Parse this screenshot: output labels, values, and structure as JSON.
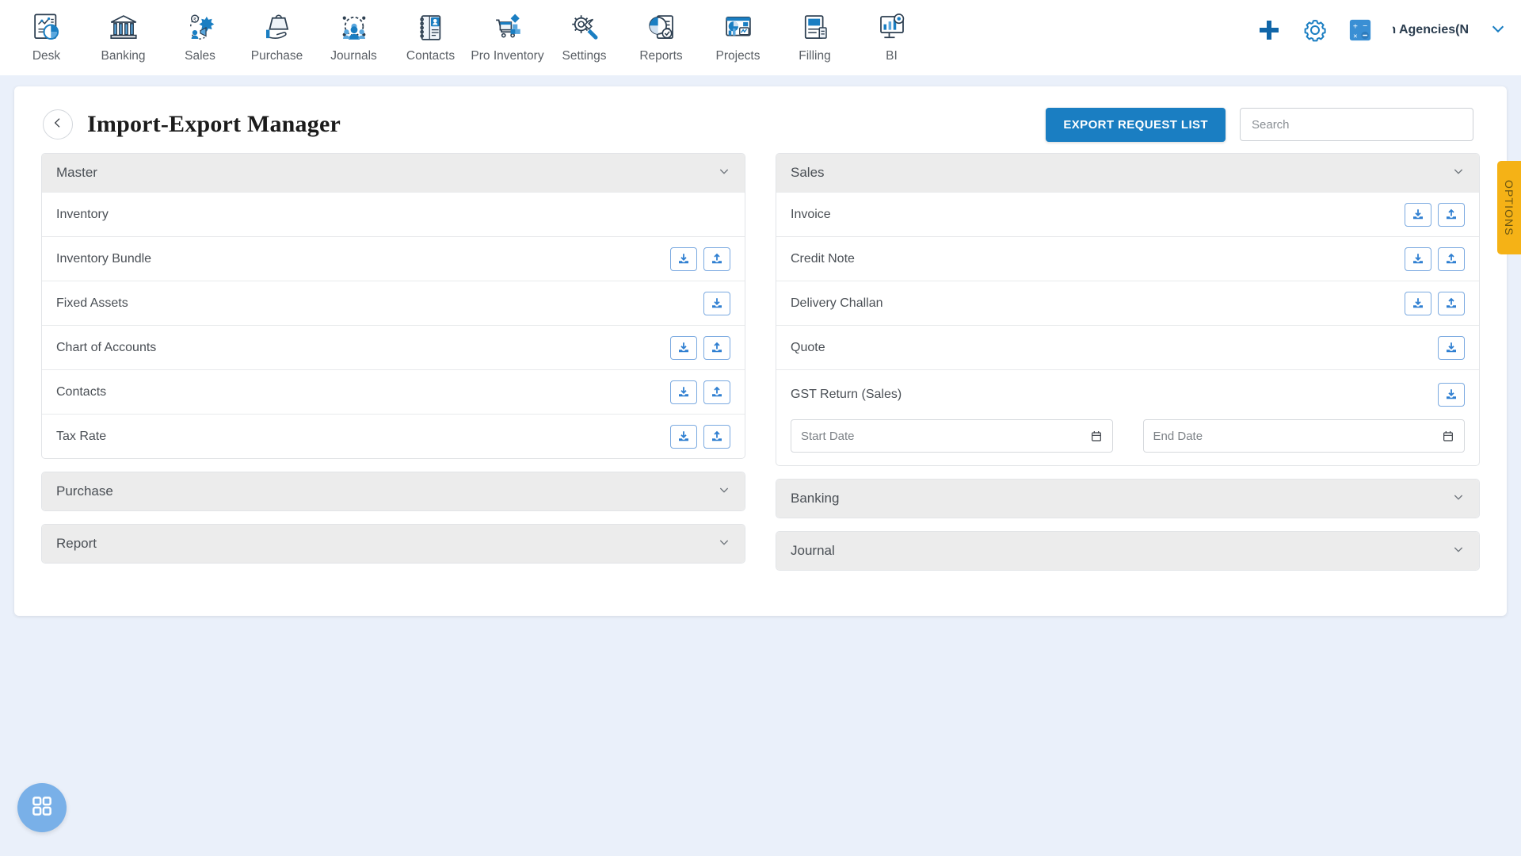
{
  "topnav": {
    "items": [
      {
        "label": "Desk",
        "icon": "dashboard-icon"
      },
      {
        "label": "Banking",
        "icon": "bank-icon"
      },
      {
        "label": "Sales",
        "icon": "sales-megaphone-icon"
      },
      {
        "label": "Purchase",
        "icon": "purchase-bag-icon"
      },
      {
        "label": "Journals",
        "icon": "journals-people-gear-icon"
      },
      {
        "label": "Contacts",
        "icon": "contacts-book-icon"
      },
      {
        "label": "Pro Inventory",
        "icon": "inventory-cart-icon"
      },
      {
        "label": "Settings",
        "icon": "settings-tools-icon"
      },
      {
        "label": "Reports",
        "icon": "reports-pie-doc-icon"
      },
      {
        "label": "Projects",
        "icon": "projects-window-icon"
      },
      {
        "label": "Filling",
        "icon": "filling-doc-icon"
      },
      {
        "label": "BI",
        "icon": "bi-monitor-icon"
      }
    ],
    "actions": {
      "add": "add-plus-icon",
      "settings": "gear-icon",
      "calculator": "calculator-icon"
    },
    "company": "h Agencies(N",
    "company_chevron": "chevron-down-icon"
  },
  "header": {
    "back": "back-chevron-icon",
    "title": "Import-Export Manager",
    "export_button": "EXPORT REQUEST LIST",
    "search_placeholder": "Search",
    "search_value": ""
  },
  "options_tab": {
    "label": "OPTIONS"
  },
  "colors": {
    "accent_blue": "#1a7ec2",
    "icon_btn_border": "#7aa9e0",
    "options_amber": "#f5b216",
    "page_bg": "#eaf0fa",
    "panel_head_bg": "#ececec",
    "fab_blue": "#79b0e8"
  },
  "left_column": [
    {
      "title": "Master",
      "expanded": true,
      "chevron": "chevron-down-icon",
      "rows": [
        {
          "label": "Inventory",
          "download": false,
          "upload": false
        },
        {
          "label": "Inventory Bundle",
          "download": true,
          "upload": true
        },
        {
          "label": "Fixed Assets",
          "download": true,
          "upload": false
        },
        {
          "label": "Chart of Accounts",
          "download": true,
          "upload": true
        },
        {
          "label": "Contacts",
          "download": true,
          "upload": true
        },
        {
          "label": "Tax Rate",
          "download": true,
          "upload": true
        }
      ]
    },
    {
      "title": "Purchase",
      "expanded": false,
      "chevron": "chevron-down-icon",
      "rows": []
    },
    {
      "title": "Report",
      "expanded": false,
      "chevron": "chevron-down-icon",
      "rows": []
    }
  ],
  "right_column": [
    {
      "title": "Sales",
      "expanded": true,
      "chevron": "chevron-down-icon",
      "rows": [
        {
          "label": "Invoice",
          "download": true,
          "upload": true
        },
        {
          "label": "Credit Note",
          "download": true,
          "upload": true
        },
        {
          "label": "Delivery Challan",
          "download": true,
          "upload": true
        },
        {
          "label": "Quote",
          "download": true,
          "upload": false
        }
      ],
      "gst": {
        "label": "GST Return (Sales)",
        "download": true,
        "start_date_placeholder": "Start Date",
        "start_date_value": "",
        "end_date_placeholder": "End Date",
        "end_date_value": "",
        "calendar_icon": "calendar-icon"
      }
    },
    {
      "title": "Banking",
      "expanded": false,
      "chevron": "chevron-down-icon",
      "rows": []
    },
    {
      "title": "Journal",
      "expanded": false,
      "chevron": "chevron-down-icon",
      "rows": []
    }
  ],
  "fab": {
    "icon": "grid-apps-icon"
  }
}
